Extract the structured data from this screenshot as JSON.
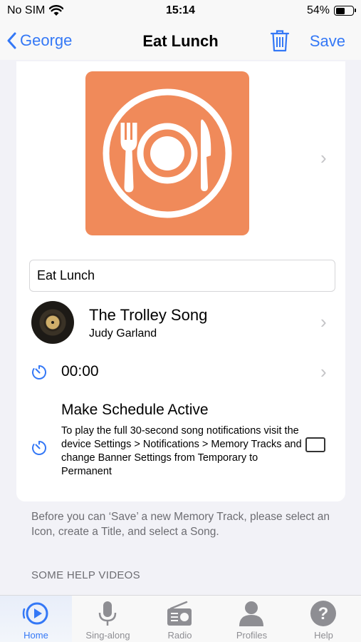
{
  "status_bar": {
    "carrier": "No SIM",
    "time": "15:14",
    "battery": "54%",
    "battery_level": 0.54
  },
  "nav": {
    "back_label": "George",
    "title": "Eat Lunch",
    "save_label": "Save"
  },
  "card": {
    "icon_name": "plate-fork-knife-icon",
    "icon_color": "#f08a5a",
    "title_value": "Eat Lunch",
    "song": {
      "title": "The Trolley Song",
      "artist": "Judy Garland"
    },
    "time": "00:00",
    "schedule": {
      "title": "Make Schedule Active",
      "description": "To play the full 30-second song notifications visit the device Settings > Notifications > Memory Tracks and change Banner Settings from Temporary to Permanent",
      "checked": false
    }
  },
  "footer_note": "Before you can ‘Save’ a new Memory Track, please select an Icon, create a Title, and select a Song.",
  "help_section_header": "SOME HELP VIDEOS",
  "tabs": [
    {
      "label": "Home",
      "icon": "home-play-icon",
      "active": true
    },
    {
      "label": "Sing-along",
      "icon": "microphone-icon",
      "active": false
    },
    {
      "label": "Radio",
      "icon": "radio-icon",
      "active": false
    },
    {
      "label": "Profiles",
      "icon": "person-icon",
      "active": false
    },
    {
      "label": "Help",
      "icon": "question-icon",
      "active": false
    }
  ],
  "colors": {
    "accent": "#3478f6",
    "background": "#f2f2f7",
    "secondary_text": "#6d6d72"
  }
}
